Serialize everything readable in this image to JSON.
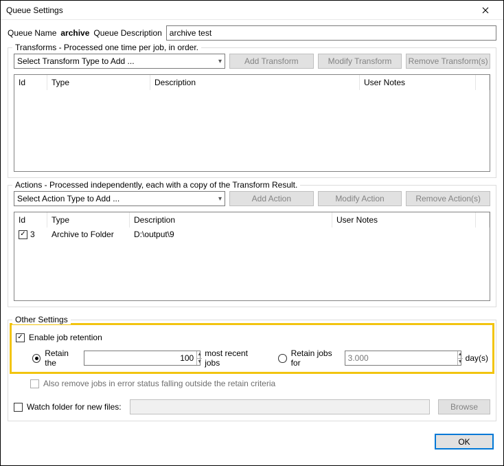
{
  "window": {
    "title": "Queue Settings"
  },
  "queue": {
    "name_label": "Queue Name",
    "name_value": "archive",
    "desc_label": "Queue Description",
    "desc_value": "archive test"
  },
  "transforms": {
    "legend": "Transforms - Processed one time per job, in order.",
    "dropdown": "Select Transform Type to Add ...",
    "add": "Add Transform",
    "modify": "Modify Transform",
    "remove": "Remove Transform(s)",
    "cols": {
      "id": "Id",
      "type": "Type",
      "desc": "Description",
      "notes": "User Notes"
    }
  },
  "actions": {
    "legend": "Actions - Processed independently, each with a copy of the Transform Result.",
    "dropdown": "Select Action Type to Add ...",
    "add": "Add Action",
    "modify": "Modify Action",
    "remove": "Remove Action(s)",
    "cols": {
      "id": "Id",
      "type": "Type",
      "desc": "Description",
      "notes": "User Notes"
    },
    "rows": [
      {
        "id": "3",
        "type": "Archive to Folder",
        "desc": "D:\\output\\9",
        "notes": ""
      }
    ]
  },
  "other": {
    "legend": "Other Settings",
    "enable": "Enable job retention",
    "retain_the": "Retain the",
    "retain_count": "100",
    "most_recent": "most recent jobs",
    "retain_for": "Retain jobs for",
    "retain_days": "3.000",
    "days": "day(s)",
    "also_remove": "Also remove jobs in error status falling outside the retain criteria",
    "watch": "Watch folder for new files:",
    "browse": "Browse"
  },
  "buttons": {
    "ok": "OK"
  }
}
